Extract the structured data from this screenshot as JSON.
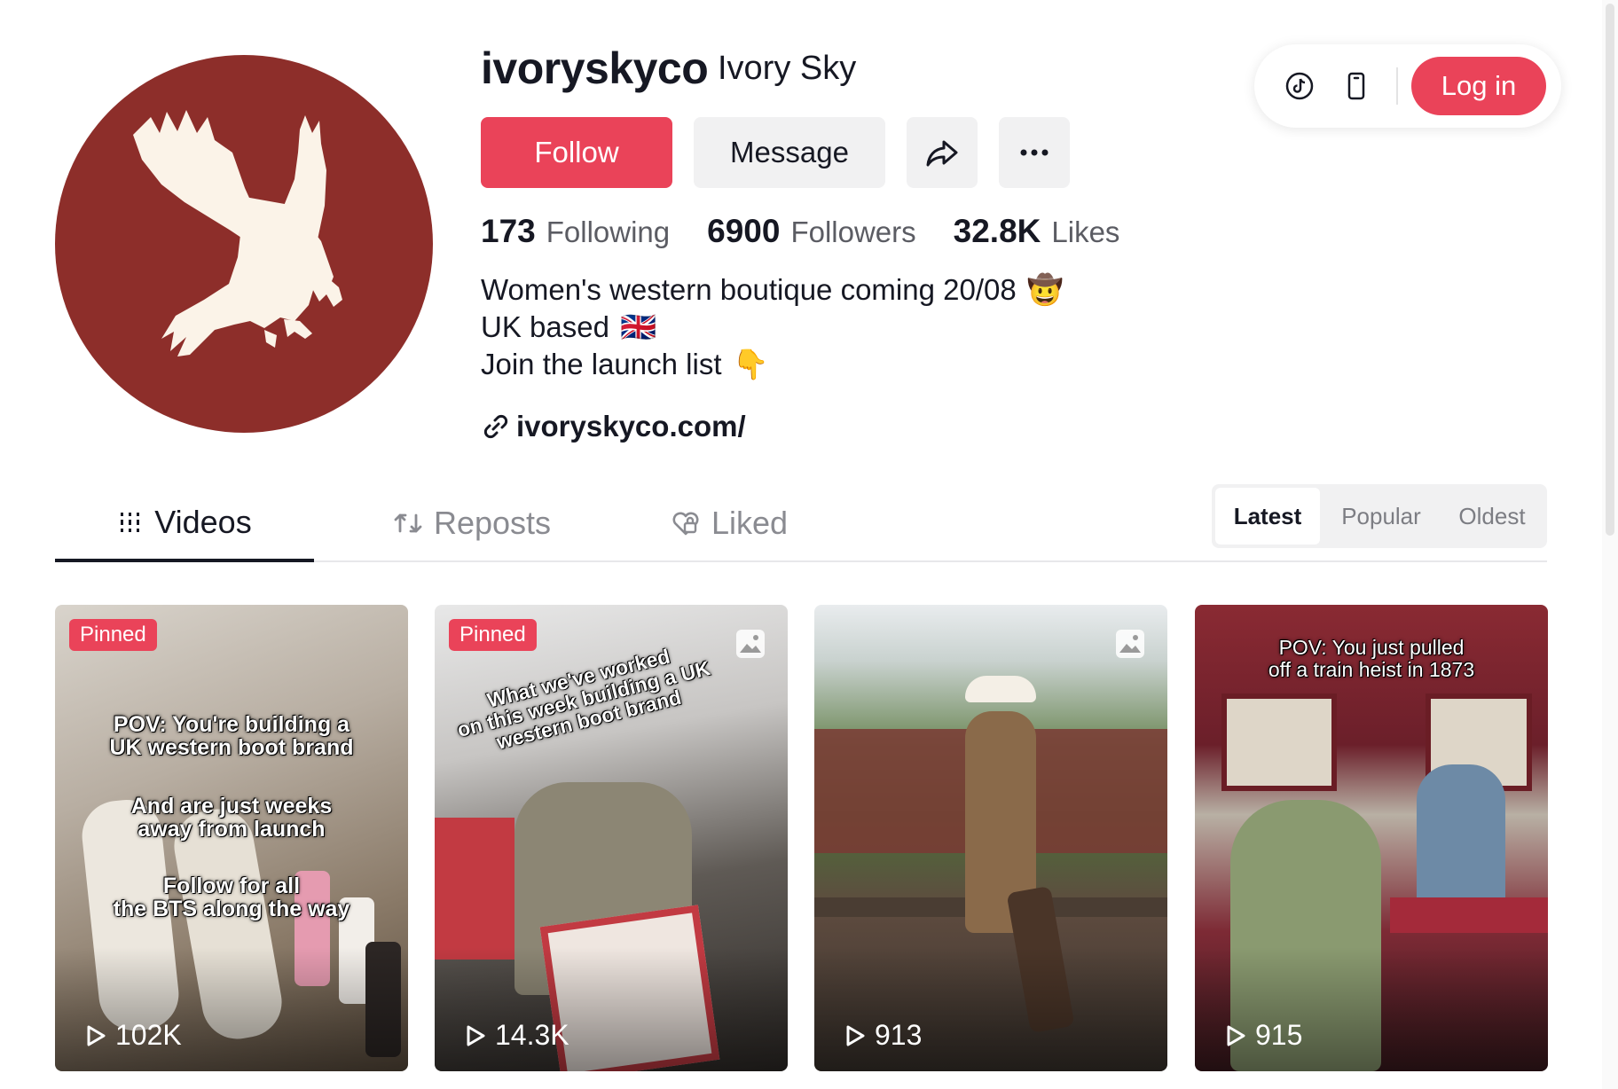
{
  "profile": {
    "username": "ivoryskyco",
    "nickname": "Ivory Sky",
    "avatar_color": "#8d2e2a",
    "follow_label": "Follow",
    "message_label": "Message",
    "share_icon": "share-icon",
    "more_icon": "more-icon",
    "stats": [
      {
        "value": "173",
        "label": "Following"
      },
      {
        "value": "6900",
        "label": "Followers"
      },
      {
        "value": "32.8K",
        "label": "Likes"
      }
    ],
    "bio": [
      {
        "text": "Women's western boutique coming 20/08",
        "emoji": "🤠"
      },
      {
        "text": "UK based",
        "emoji": "🇬🇧"
      },
      {
        "text": "Join the launch list",
        "emoji": "👇"
      }
    ],
    "link": "ivoryskyco.com/"
  },
  "topbar": {
    "login_label": "Log in",
    "icons": [
      "tiktok-icon",
      "phone-icon"
    ]
  },
  "tabs": {
    "videos": "Videos",
    "reposts": "Reposts",
    "liked": "Liked"
  },
  "sort": {
    "latest": "Latest",
    "popular": "Popular",
    "oldest": "Oldest",
    "selected": "Latest"
  },
  "videos": [
    {
      "pinned": "Pinned",
      "views": "102K",
      "overlay": [
        "POV: You're building a\nUK western boot brand",
        "And are just weeks\naway from launch",
        "Follow for all\nthe BTS along the way"
      ]
    },
    {
      "pinned": "Pinned",
      "views": "14.3K",
      "overlay": [
        "What we've worked\non this week building a UK\nwestern boot brand"
      ],
      "photo": true
    },
    {
      "views": "913",
      "photo": true
    },
    {
      "views": "915",
      "overlay": [
        "POV: You just pulled\noff a train heist in 1873"
      ]
    }
  ],
  "colors": {
    "accent": "#ea4359",
    "text": "#161823",
    "muted": "#8a8b91",
    "button_bg": "#f1f1f2"
  }
}
